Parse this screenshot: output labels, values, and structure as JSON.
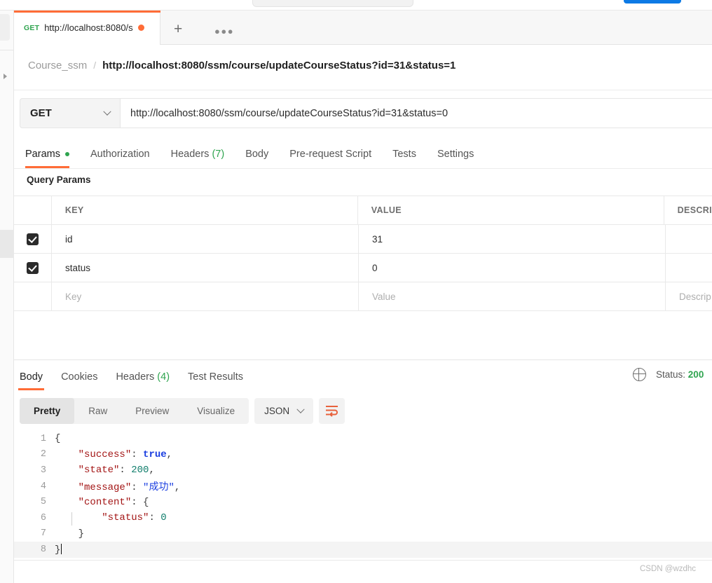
{
  "tab": {
    "method": "GET",
    "title": "http://localhost:8080/s",
    "unsaved_dot": "unsaved-changes-dot",
    "new_tab_label": "+",
    "more_label": "●●●"
  },
  "breadcrumb": {
    "collection": "Course_ssm",
    "separator": "/",
    "request_name": "http://localhost:8080/ssm/course/updateCourseStatus?id=31&status=1"
  },
  "request": {
    "method": "GET",
    "url": "http://localhost:8080/ssm/course/updateCourseStatus?id=31&status=0",
    "tabs": [
      {
        "label": "Params",
        "active": true,
        "dot": true
      },
      {
        "label": "Authorization",
        "active": false
      },
      {
        "label": "Headers",
        "count": "(7)",
        "active": false
      },
      {
        "label": "Body",
        "active": false
      },
      {
        "label": "Pre-request Script",
        "active": false
      },
      {
        "label": "Tests",
        "active": false
      },
      {
        "label": "Settings",
        "active": false
      }
    ],
    "query_params_title": "Query Params",
    "table": {
      "headers": [
        "KEY",
        "VALUE",
        "DESCRI"
      ],
      "rows": [
        {
          "checked": true,
          "key": "id",
          "value": "31",
          "description": ""
        },
        {
          "checked": true,
          "key": "status",
          "value": "0",
          "description": ""
        }
      ],
      "placeholder_row": {
        "key": "Key",
        "value": "Value",
        "description": "Descrip"
      }
    }
  },
  "response": {
    "tabs": [
      {
        "label": "Body",
        "active": true
      },
      {
        "label": "Cookies",
        "active": false
      },
      {
        "label": "Headers",
        "count": "(4)",
        "active": false
      },
      {
        "label": "Test Results",
        "active": false
      }
    ],
    "status_label": "Status:",
    "status_code": "200",
    "view_modes": [
      {
        "label": "Pretty",
        "active": true
      },
      {
        "label": "Raw",
        "active": false
      },
      {
        "label": "Preview",
        "active": false
      },
      {
        "label": "Visualize",
        "active": false
      }
    ],
    "format": "JSON",
    "wrap_icon": "word-wrap-icon",
    "globe_icon": "globe-icon",
    "body_lines": [
      {
        "n": "1",
        "html": "<span class=\"pun\">{</span>"
      },
      {
        "n": "2",
        "html": "    <span class=\"k\">\"success\"</span><span class=\"pun\">: </span><span class=\"bool\">true</span><span class=\"pun\">,</span>"
      },
      {
        "n": "3",
        "html": "    <span class=\"k\">\"state\"</span><span class=\"pun\">: </span><span class=\"num\">200</span><span class=\"pun\">,</span>"
      },
      {
        "n": "4",
        "html": "    <span class=\"k\">\"message\"</span><span class=\"pun\">: </span><span class=\"str\">\"成功\"</span><span class=\"pun\">,</span>"
      },
      {
        "n": "5",
        "html": "    <span class=\"k\">\"content\"</span><span class=\"pun\">: {</span>"
      },
      {
        "n": "6",
        "html": "        <span class=\"k\">\"status\"</span><span class=\"pun\">: </span><span class=\"num\">0</span>"
      },
      {
        "n": "7",
        "html": "    <span class=\"pun\">}</span>"
      },
      {
        "n": "8",
        "html": "<span class=\"pun\">}</span><span class=\"caret\"></span>"
      }
    ],
    "body_json": {
      "success": true,
      "state": 200,
      "message": "成功",
      "content": {
        "status": 0
      }
    }
  },
  "watermark": "CSDN @wzdhc",
  "colors": {
    "accent": "#ff6c37",
    "success": "#2fa44f",
    "blue_button": "#0d7ae5"
  }
}
